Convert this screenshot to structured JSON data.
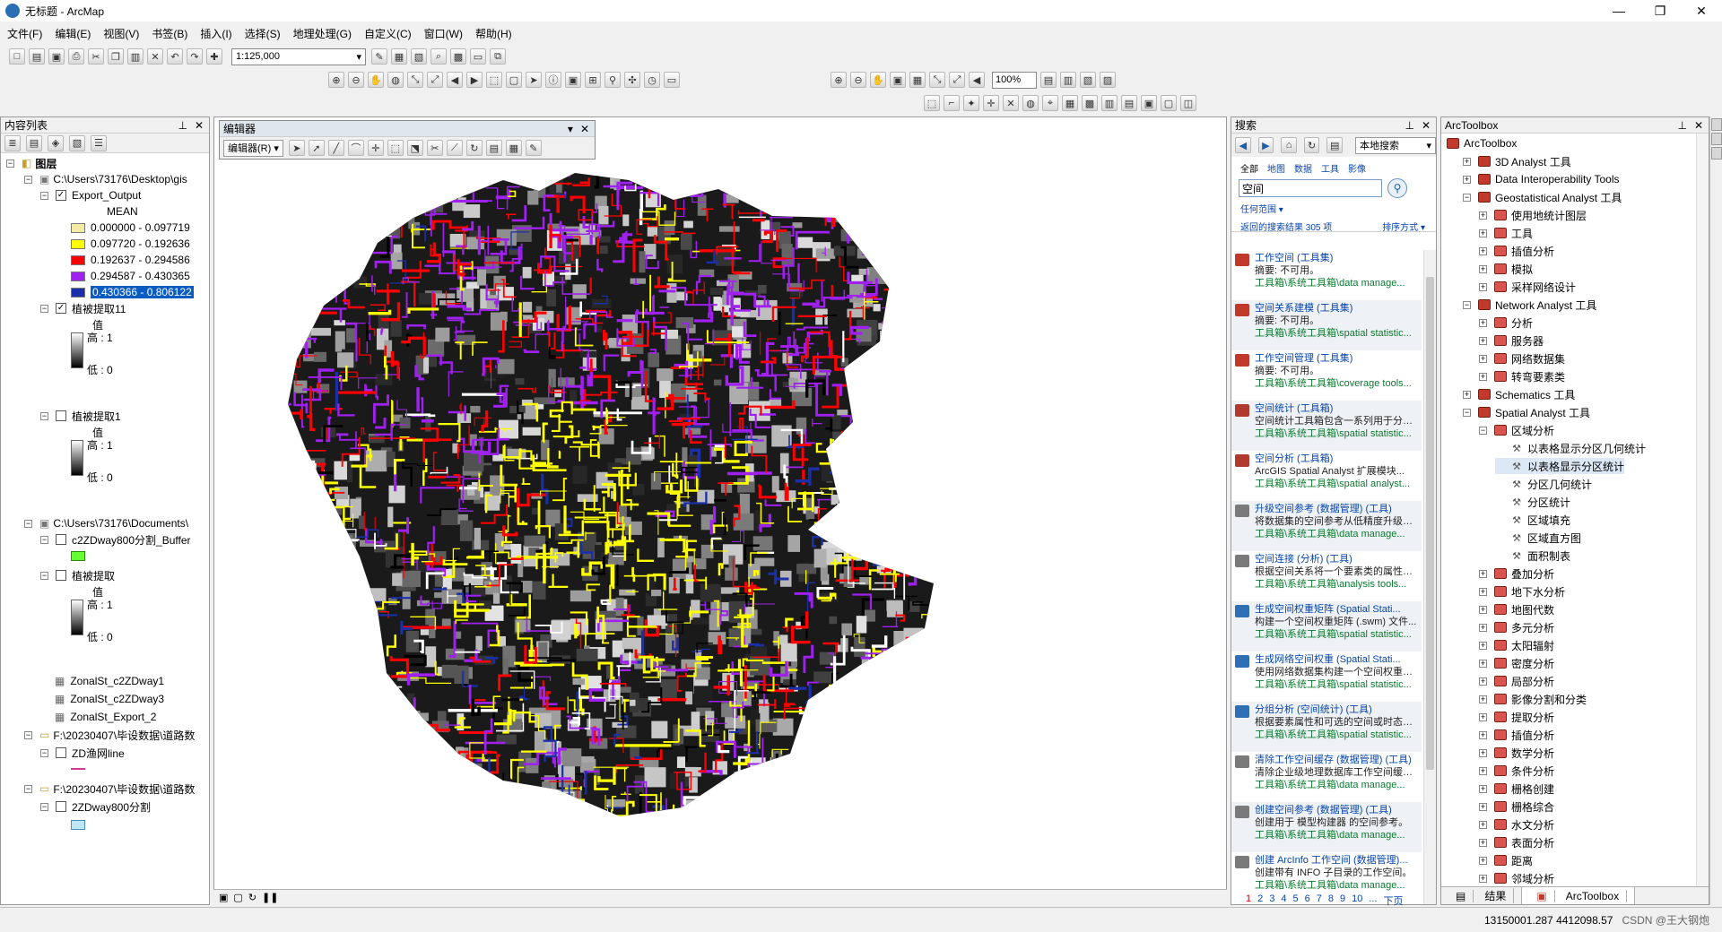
{
  "window": {
    "title": "无标题 - ArcMap",
    "controls": [
      "—",
      "❐",
      "✕"
    ]
  },
  "menu": [
    "文件(F)",
    "编辑(E)",
    "视图(V)",
    "书签(B)",
    "插入(I)",
    "选择(S)",
    "地理处理(G)",
    "自定义(C)",
    "窗口(W)",
    "帮助(H)"
  ],
  "toolbar": {
    "scale": "1:125,000",
    "zoom": "100%"
  },
  "toc": {
    "title": "内容列表",
    "root": "图层",
    "rows": [
      {
        "text": "C:\\Users\\73176\\Desktop\\gis"
      },
      {
        "text": "Export_Output"
      },
      {
        "text": "MEAN"
      },
      {
        "text": "0.000000 - 0.097719",
        "color": "#f3eaa6"
      },
      {
        "text": "0.097720 - 0.192636",
        "color": "#ffff00"
      },
      {
        "text": "0.192637 - 0.294586",
        "color": "#ff0000"
      },
      {
        "text": "0.294587 - 0.430365",
        "color": "#a020f0"
      },
      {
        "text": "0.430366 - 0.806122",
        "color": "#1a2fa8"
      },
      {
        "text": "植被提取11"
      },
      {
        "text": "值"
      },
      {
        "text": "高 : 1"
      },
      {
        "text": "低 : 0"
      },
      {
        "text": "植被提取1"
      },
      {
        "text": "值"
      },
      {
        "text": "高 : 1"
      },
      {
        "text": "低 : 0"
      },
      {
        "text": "C:\\Users\\73176\\Documents\\"
      },
      {
        "text": "c2ZDway800分割_Buffer"
      },
      {
        "text": "植被提取"
      },
      {
        "text": "值"
      },
      {
        "text": "高 : 1"
      },
      {
        "text": "低 : 0"
      },
      {
        "text": "ZonalSt_c2ZDway1"
      },
      {
        "text": "ZonalSt_c2ZDway3"
      },
      {
        "text": "ZonalSt_Export_2"
      },
      {
        "text": "F:\\20230407\\毕设数据\\道路数"
      },
      {
        "text": "ZD渔网line"
      },
      {
        "text": "F:\\20230407\\毕设数据\\道路数"
      },
      {
        "text": "2ZDway800分割"
      }
    ]
  },
  "editor": {
    "title": "编辑器",
    "menu_label": "编辑器(R) ▾"
  },
  "search": {
    "title": "搜索",
    "scope": "本地搜索",
    "filters": [
      "全部",
      "地图",
      "数据",
      "工具",
      "影像"
    ],
    "query": "空间",
    "where_link": "任何范围 ▾",
    "results_count": "返回的搜索结果 305 项",
    "sort": "排序方式 ▾",
    "results": [
      {
        "title": "工作空间 (工具集)",
        "desc": "摘要: 不可用。",
        "path": "工具箱\\系统工具箱\\data manage...",
        "icon": "toolset"
      },
      {
        "title": "空间关系建模 (工具集)",
        "desc": "摘要: 不可用。",
        "path": "工具箱\\系统工具箱\\spatial statistic...",
        "icon": "toolset"
      },
      {
        "title": "工作空间管理 (工具集)",
        "desc": "摘要: 不可用。",
        "path": "工具箱\\系统工具箱\\coverage tools...",
        "icon": "toolset"
      },
      {
        "title": "空间统计 (工具箱)",
        "desc": "空间统计工具箱包含一系列用于分析...",
        "path": "工具箱\\系统工具箱\\spatial statistic...",
        "icon": "toolbox"
      },
      {
        "title": "空间分析 (工具箱)",
        "desc": "ArcGIS Spatial Analyst 扩展模块...",
        "path": "工具箱\\系统工具箱\\spatial analyst...",
        "icon": "toolbox"
      },
      {
        "title": "升级空间参考 (数据管理) (工具)",
        "desc": "将数据集的空间参考从低精度升级为...",
        "path": "工具箱\\系统工具箱\\data manage...",
        "icon": "tool"
      },
      {
        "title": "空间连接 (分析) (工具)",
        "desc": "根据空间关系将一个要素类的属性连...",
        "path": "工具箱\\系统工具箱\\analysis tools...",
        "icon": "tool"
      },
      {
        "title": "生成空间权重矩阵 (Spatial Stati...",
        "desc": "构建一个空间权重矩阵 (.swm) 文件...",
        "path": "工具箱\\系统工具箱\\spatial statistic...",
        "icon": "script"
      },
      {
        "title": "生成网络空间权重 (Spatial Stati...",
        "desc": "使用网络数据集构建一个空间权重矩...",
        "path": "工具箱\\系统工具箱\\spatial statistic...",
        "icon": "script"
      },
      {
        "title": "分组分析 (空间统计) (工具)",
        "desc": "根据要素属性和可选的空间或时态约...",
        "path": "工具箱\\系统工具箱\\spatial statistic...",
        "icon": "script"
      },
      {
        "title": "清除工作空间缓存 (数据管理) (工具)",
        "desc": "清除企业级地理数据库工作空间缓存...",
        "path": "工具箱\\系统工具箱\\data manage...",
        "icon": "tool"
      },
      {
        "title": "创建空间参考 (数据管理) (工具)",
        "desc": "创建用于 模型构建器 的空间参考。",
        "path": "工具箱\\系统工具箱\\data manage...",
        "icon": "tool"
      },
      {
        "title": "创建 ArcInfo 工作空间 (数据管理)...",
        "desc": "创建带有 INFO 子目录的工作空间。",
        "path": "工具箱\\系统工具箱\\data manage...",
        "icon": "tool"
      }
    ],
    "pager": [
      "1",
      "2",
      "3",
      "4",
      "5",
      "6",
      "7",
      "8",
      "9",
      "10",
      "...",
      "下页"
    ]
  },
  "arctoolbox": {
    "title": "ArcToolbox",
    "items": [
      {
        "text": "ArcToolbox",
        "level": 0,
        "type": "root"
      },
      {
        "text": "3D Analyst 工具",
        "level": 1,
        "type": "toolbox",
        "exp": "+"
      },
      {
        "text": "Data Interoperability Tools",
        "level": 1,
        "type": "toolbox",
        "exp": "+"
      },
      {
        "text": "Geostatistical Analyst 工具",
        "level": 1,
        "type": "toolbox",
        "exp": "−"
      },
      {
        "text": "使用地统计图层",
        "level": 2,
        "type": "toolset",
        "exp": "+"
      },
      {
        "text": "工具",
        "level": 2,
        "type": "toolset",
        "exp": "+"
      },
      {
        "text": "插值分析",
        "level": 2,
        "type": "toolset",
        "exp": "+"
      },
      {
        "text": "模拟",
        "level": 2,
        "type": "toolset",
        "exp": "+"
      },
      {
        "text": "采样网络设计",
        "level": 2,
        "type": "toolset",
        "exp": "+"
      },
      {
        "text": "Network Analyst 工具",
        "level": 1,
        "type": "toolbox",
        "exp": "−"
      },
      {
        "text": "分析",
        "level": 2,
        "type": "toolset",
        "exp": "+"
      },
      {
        "text": "服务器",
        "level": 2,
        "type": "toolset",
        "exp": "+"
      },
      {
        "text": "网络数据集",
        "level": 2,
        "type": "toolset",
        "exp": "+"
      },
      {
        "text": "转弯要素类",
        "level": 2,
        "type": "toolset",
        "exp": "+"
      },
      {
        "text": "Schematics 工具",
        "level": 1,
        "type": "toolbox",
        "exp": "+"
      },
      {
        "text": "Spatial Analyst 工具",
        "level": 1,
        "type": "toolbox",
        "exp": "−"
      },
      {
        "text": "区域分析",
        "level": 2,
        "type": "toolset",
        "exp": "−"
      },
      {
        "text": "以表格显示分区几何统计",
        "level": 3,
        "type": "tool"
      },
      {
        "text": "以表格显示分区统计",
        "level": 3,
        "type": "tool",
        "hl": true
      },
      {
        "text": "分区几何统计",
        "level": 3,
        "type": "tool"
      },
      {
        "text": "分区统计",
        "level": 3,
        "type": "tool"
      },
      {
        "text": "区域填充",
        "level": 3,
        "type": "tool"
      },
      {
        "text": "区域直方图",
        "level": 3,
        "type": "tool"
      },
      {
        "text": "面积制表",
        "level": 3,
        "type": "tool"
      },
      {
        "text": "叠加分析",
        "level": 2,
        "type": "toolset",
        "exp": "+"
      },
      {
        "text": "地下水分析",
        "level": 2,
        "type": "toolset",
        "exp": "+"
      },
      {
        "text": "地图代数",
        "level": 2,
        "type": "toolset",
        "exp": "+"
      },
      {
        "text": "多元分析",
        "level": 2,
        "type": "toolset",
        "exp": "+"
      },
      {
        "text": "太阳辐射",
        "level": 2,
        "type": "toolset",
        "exp": "+"
      },
      {
        "text": "密度分析",
        "level": 2,
        "type": "toolset",
        "exp": "+"
      },
      {
        "text": "局部分析",
        "level": 2,
        "type": "toolset",
        "exp": "+"
      },
      {
        "text": "影像分割和分类",
        "level": 2,
        "type": "toolset",
        "exp": "+"
      },
      {
        "text": "提取分析",
        "level": 2,
        "type": "toolset",
        "exp": "+"
      },
      {
        "text": "插值分析",
        "level": 2,
        "type": "toolset",
        "exp": "+"
      },
      {
        "text": "数学分析",
        "level": 2,
        "type": "toolset",
        "exp": "+"
      },
      {
        "text": "条件分析",
        "level": 2,
        "type": "toolset",
        "exp": "+"
      },
      {
        "text": "栅格创建",
        "level": 2,
        "type": "toolset",
        "exp": "+"
      },
      {
        "text": "栅格综合",
        "level": 2,
        "type": "toolset",
        "exp": "+"
      },
      {
        "text": "水文分析",
        "level": 2,
        "type": "toolset",
        "exp": "+"
      },
      {
        "text": "表面分析",
        "level": 2,
        "type": "toolset",
        "exp": "+"
      },
      {
        "text": "距离",
        "level": 2,
        "type": "toolset",
        "exp": "+"
      },
      {
        "text": "邻域分析",
        "level": 2,
        "type": "toolset",
        "exp": "+"
      }
    ],
    "tabs": [
      "结果",
      "ArcToolbox"
    ]
  },
  "status": {
    "coords": "13150001.287  4412098.57",
    "watermark": "CSDN @王大钢炮"
  },
  "colors": {
    "accent": "#0a5cc2",
    "link": "#0645ad",
    "path_green": "#0a7a2e",
    "map_yellow": "#ffff00",
    "map_red": "#ff0000",
    "map_purple": "#a020f0",
    "map_blue": "#1a2fa8"
  }
}
